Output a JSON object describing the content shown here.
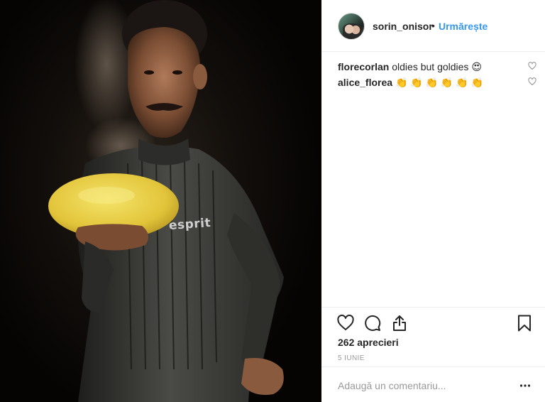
{
  "post": {
    "photo_description_icon": "photo-icon",
    "photo_brand_text": "esprit"
  },
  "header": {
    "username": "sorin_onisor",
    "separator": "•",
    "follow_label": "Urmărește"
  },
  "comments": [
    {
      "user": "florecorlan",
      "text": "oldies but goldies 😍"
    },
    {
      "user": "alice_florea",
      "text": "👏 👏 👏 👏 👏 👏"
    }
  ],
  "actions": {
    "like_icon": "heart-icon",
    "comment_icon": "comment-icon",
    "share_icon": "share-icon",
    "save_icon": "bookmark-icon",
    "likes_text": "262 aprecieri",
    "date_text": "5 IUNIE"
  },
  "comment_box": {
    "placeholder": "Adaugă un comentariu..."
  },
  "colors": {
    "accent": "#3897f0",
    "text": "#262626",
    "muted": "#999999",
    "divider": "#efefef"
  }
}
